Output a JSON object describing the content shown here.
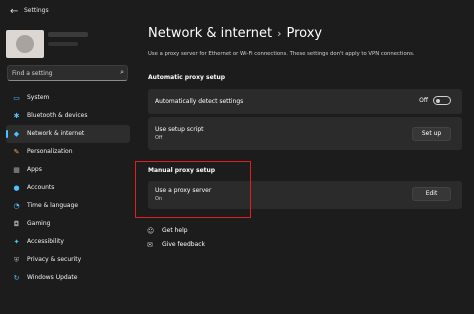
{
  "window": {
    "title": "Settings"
  },
  "search": {
    "placeholder": "Find a setting",
    "icon": "search-icon"
  },
  "sidebar": {
    "items": [
      {
        "label": "System",
        "icon": "monitor-icon",
        "glyph": "▭",
        "color": "#4cc2ff",
        "active": false
      },
      {
        "label": "Bluetooth & devices",
        "icon": "bluetooth-icon",
        "glyph": "✱",
        "color": "#4cc2ff",
        "active": false
      },
      {
        "label": "Network & internet",
        "icon": "wifi-icon",
        "glyph": "◆",
        "color": "#4cc2ff",
        "active": true
      },
      {
        "label": "Personalization",
        "icon": "brush-icon",
        "glyph": "✎",
        "color": "#f2a65a",
        "active": false
      },
      {
        "label": "Apps",
        "icon": "apps-icon",
        "glyph": "▦",
        "color": "#a0a0a0",
        "active": false
      },
      {
        "label": "Accounts",
        "icon": "person-icon",
        "glyph": "●",
        "color": "#4cc2ff",
        "active": false
      },
      {
        "label": "Time & language",
        "icon": "globe-clock-icon",
        "glyph": "◔",
        "color": "#4cc2ff",
        "active": false
      },
      {
        "label": "Gaming",
        "icon": "gamepad-icon",
        "glyph": "◘",
        "color": "#a0a0a0",
        "active": false
      },
      {
        "label": "Accessibility",
        "icon": "accessibility-icon",
        "glyph": "✦",
        "color": "#4cc2ff",
        "active": false
      },
      {
        "label": "Privacy & security",
        "icon": "shield-icon",
        "glyph": "⛨",
        "color": "#a0a0a0",
        "active": false
      },
      {
        "label": "Windows Update",
        "icon": "update-icon",
        "glyph": "↻",
        "color": "#4cc2ff",
        "active": false
      }
    ]
  },
  "header": {
    "breadcrumb_parent": "Network & internet",
    "breadcrumb_current": "Proxy",
    "description": "Use a proxy server for Ethernet or Wi-Fi connections. These settings don't apply to VPN connections."
  },
  "automatic": {
    "title": "Automatic proxy setup",
    "detect_label": "Automatically detect settings",
    "detect_state": "Off",
    "script_label": "Use setup script",
    "script_state": "Off",
    "script_button": "Set up"
  },
  "manual": {
    "title": "Manual proxy setup",
    "proxy_label": "Use a proxy server",
    "proxy_state": "On",
    "edit_button": "Edit"
  },
  "links": {
    "help": "Get help",
    "feedback": "Give feedback"
  },
  "colors": {
    "accent": "#4cc2ff",
    "highlight": "#e02020"
  }
}
